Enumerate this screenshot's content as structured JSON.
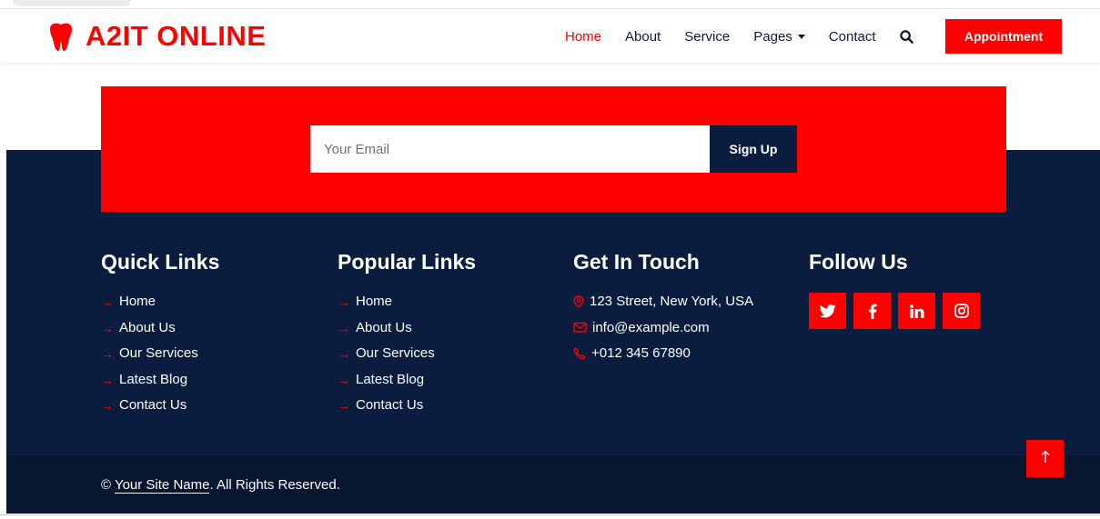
{
  "brand": {
    "name": "A2IT ONLINE",
    "logo_icon": "tooth-icon"
  },
  "nav": {
    "items": [
      {
        "label": "Home",
        "active": true
      },
      {
        "label": "About",
        "active": false
      },
      {
        "label": "Service",
        "active": false
      },
      {
        "label": "Pages",
        "active": false,
        "dropdown": true
      },
      {
        "label": "Contact",
        "active": false
      }
    ],
    "appointment_label": "Appointment"
  },
  "newsletter": {
    "placeholder": "Your Email",
    "button_label": "Sign Up"
  },
  "quick_links": {
    "title": "Quick Links",
    "items": [
      "Home",
      "About Us",
      "Our Services",
      "Latest Blog",
      "Contact Us"
    ]
  },
  "popular_links": {
    "title": "Popular Links",
    "items": [
      "Home",
      "About Us",
      "Our Services",
      "Latest Blog",
      "Contact Us"
    ]
  },
  "contact": {
    "title": "Get In Touch",
    "address": "123 Street, New York, USA",
    "email": "info@example.com",
    "phone": "+012 345 67890"
  },
  "follow": {
    "title": "Follow Us",
    "icons": [
      "twitter-icon",
      "facebook-icon",
      "linkedin-icon",
      "instagram-icon"
    ]
  },
  "copyright": {
    "prefix": "© ",
    "site_name": "Your Site Name",
    "suffix": ". All Rights Reserved."
  },
  "colors": {
    "accent": "#ff0000",
    "footer": "#0b1d3f",
    "footer_bottom": "#081630"
  }
}
